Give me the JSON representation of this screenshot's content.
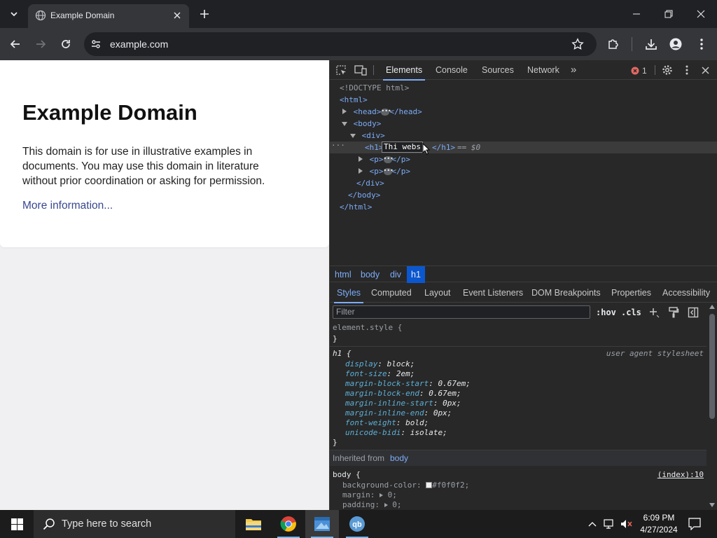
{
  "browser": {
    "tab_title": "Example Domain",
    "url": "example.com"
  },
  "page": {
    "heading": "Example Domain",
    "description": "This domain is for use in illustrative examples in documents. You may use this domain in literature without prior coordination or asking for permission.",
    "link": "More information..."
  },
  "devtools": {
    "tabs": [
      "Elements",
      "Console",
      "Sources",
      "Network"
    ],
    "more_tabs": "»",
    "error_count": "1",
    "dom": {
      "doctype": "<!DOCTYPE html>",
      "html_open": "<html>",
      "head_open": "<head>",
      "head_close": "</head>",
      "body_open": "<body>",
      "div_open": "<div>",
      "h1_open": "<h1>",
      "h1_edit": "Thi webs",
      "h1_close": "</h1>",
      "h1_marker": "== $0",
      "p_open": "<p>",
      "p_close": "</p>",
      "div_close": "</div>",
      "body_close": "</body>",
      "html_close": "</html>"
    },
    "breadcrumbs": [
      "html",
      "body",
      "div",
      "h1"
    ],
    "subtabs": [
      "Styles",
      "Computed",
      "Layout",
      "Event Listeners",
      "DOM Breakpoints",
      "Properties",
      "Accessibility"
    ],
    "filter_placeholder": "Filter",
    "hov": ":hov",
    "cls": ".cls",
    "styles": {
      "element_style": "element.style {",
      "close_brace": "}",
      "h1_selector": "h1 {",
      "ua_label": "user agent stylesheet",
      "h1_props": [
        {
          "name": "display",
          "value": "block;"
        },
        {
          "name": "font-size",
          "value": "2em;"
        },
        {
          "name": "margin-block-start",
          "value": "0.67em;"
        },
        {
          "name": "margin-block-end",
          "value": "0.67em;"
        },
        {
          "name": "margin-inline-start",
          "value": "0px;"
        },
        {
          "name": "margin-inline-end",
          "value": "0px;"
        },
        {
          "name": "font-weight",
          "value": "bold;"
        },
        {
          "name": "unicode-bidi",
          "value": "isolate;"
        }
      ],
      "inherited_label": "Inherited from",
      "inherited_from": "body",
      "body_selector": "body {",
      "body_source": "(index):10",
      "body_props": [
        {
          "name": "background-color",
          "value": "#f0f0f2;"
        },
        {
          "name": "margin",
          "value": "0;"
        },
        {
          "name": "padding",
          "value": "0;"
        }
      ]
    }
  },
  "taskbar": {
    "search_placeholder": "Type here to search",
    "time": "6:09 PM",
    "date": "4/27/2024"
  },
  "colors": {
    "accent": "#7cacf8",
    "selected_crumb": "#0b57d0",
    "error": "#e46962",
    "page_bg": "#f0f0f2"
  }
}
